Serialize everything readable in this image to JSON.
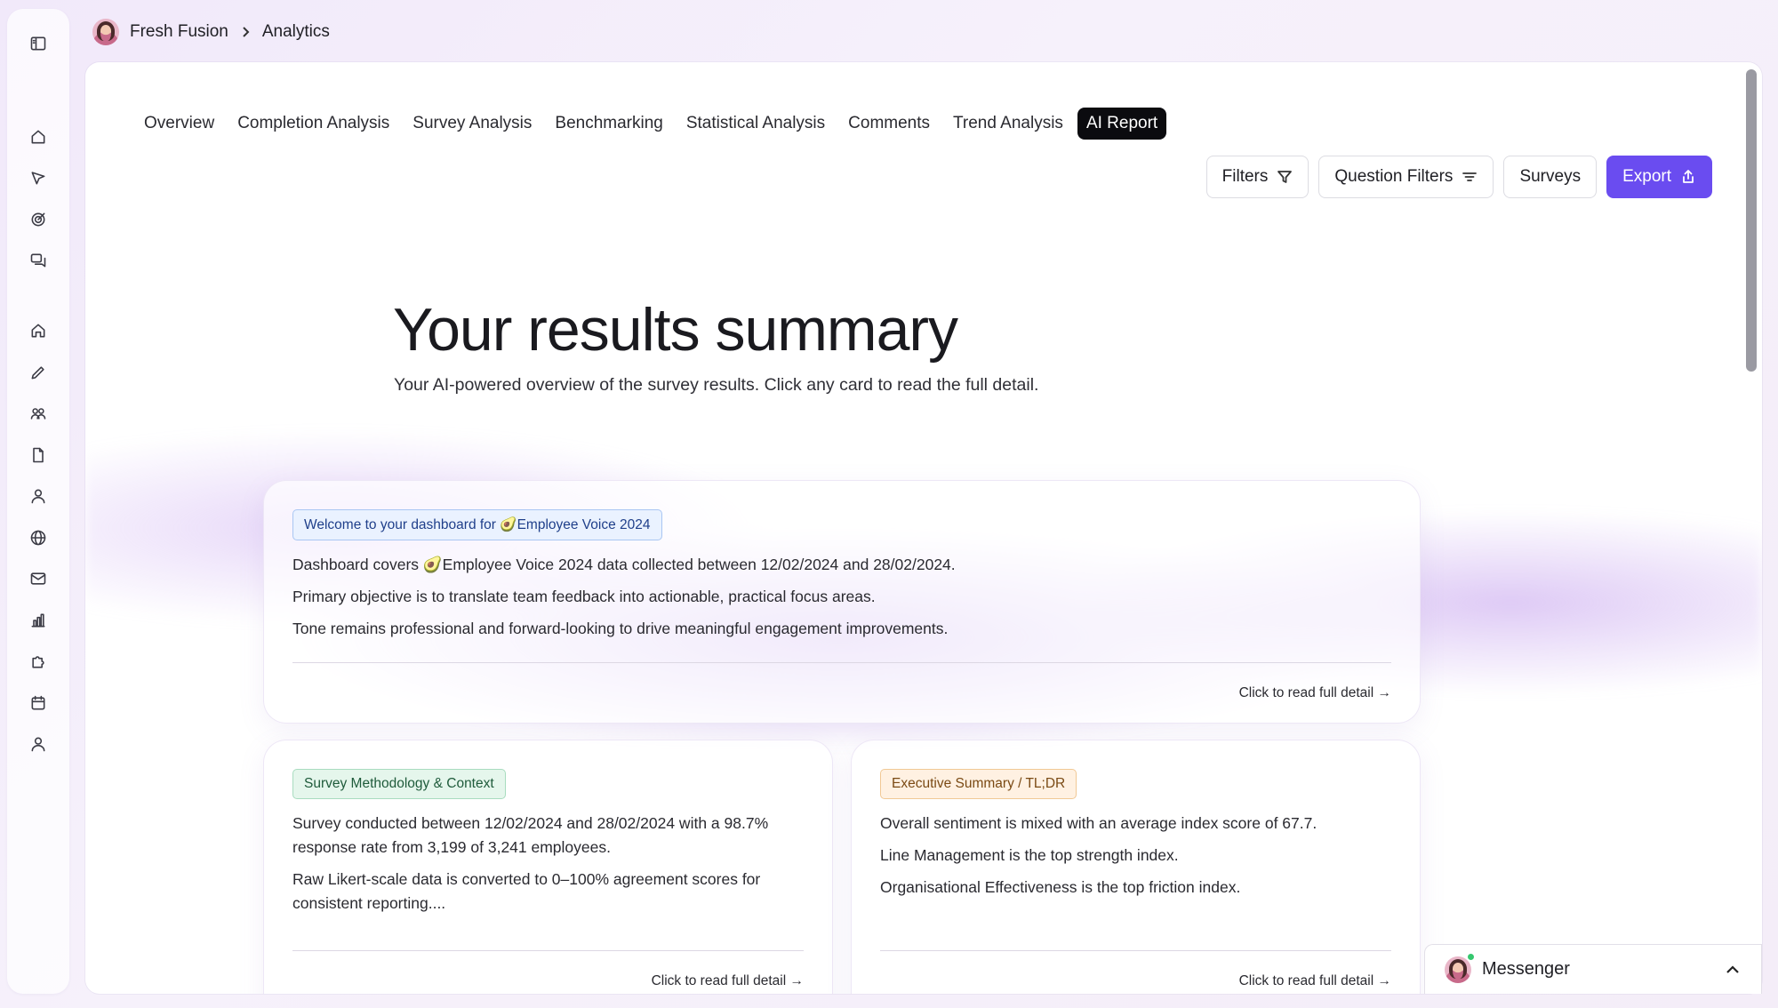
{
  "breadcrumb": {
    "workspace": "Fresh Fusion",
    "page": "Analytics"
  },
  "tabs": [
    {
      "label": "Overview"
    },
    {
      "label": "Completion Analysis"
    },
    {
      "label": "Survey Analysis"
    },
    {
      "label": "Benchmarking"
    },
    {
      "label": "Statistical Analysis"
    },
    {
      "label": "Comments"
    },
    {
      "label": "Trend Analysis"
    },
    {
      "label": "AI Report",
      "active": true
    }
  ],
  "toolbar": {
    "filters_label": "Filters",
    "question_filters_label": "Question Filters",
    "surveys_label": "Surveys",
    "export_label": "Export"
  },
  "hero": {
    "title": "Your results summary",
    "subtitle": "Your AI-powered overview of the survey results. Click any card to read the full detail."
  },
  "cards": {
    "welcome": {
      "tag": "Welcome to your dashboard for 🥑Employee Voice 2024",
      "lines": [
        "Dashboard covers 🥑Employee Voice 2024 data collected between 12/02/2024 and 28/02/2024.",
        "Primary objective is to translate team feedback into actionable, practical focus areas.",
        "Tone remains professional and forward-looking to drive meaningful engagement improvements."
      ],
      "footer": "Click to read full detail →"
    },
    "methodology": {
      "tag": "Survey Methodology & Context",
      "lines": [
        "Survey conducted between 12/02/2024 and 28/02/2024 with a 98.7% response rate from 3,199 of 3,241 employees.",
        "Raw Likert-scale data is converted to 0–100% agreement scores for consistent reporting...."
      ],
      "footer": "Click to read full detail →"
    },
    "executive": {
      "tag": "Executive Summary / TL;DR",
      "lines": [
        "Overall sentiment is mixed with an average index score of 67.7.",
        "Line Management is the top strength index.",
        "Organisational Effectiveness is the top friction index."
      ],
      "footer": "Click to read full detail →"
    }
  },
  "messenger": {
    "label": "Messenger"
  },
  "colors": {
    "accent": "#6a4cf0",
    "active_tab": "#0b0b0f"
  }
}
